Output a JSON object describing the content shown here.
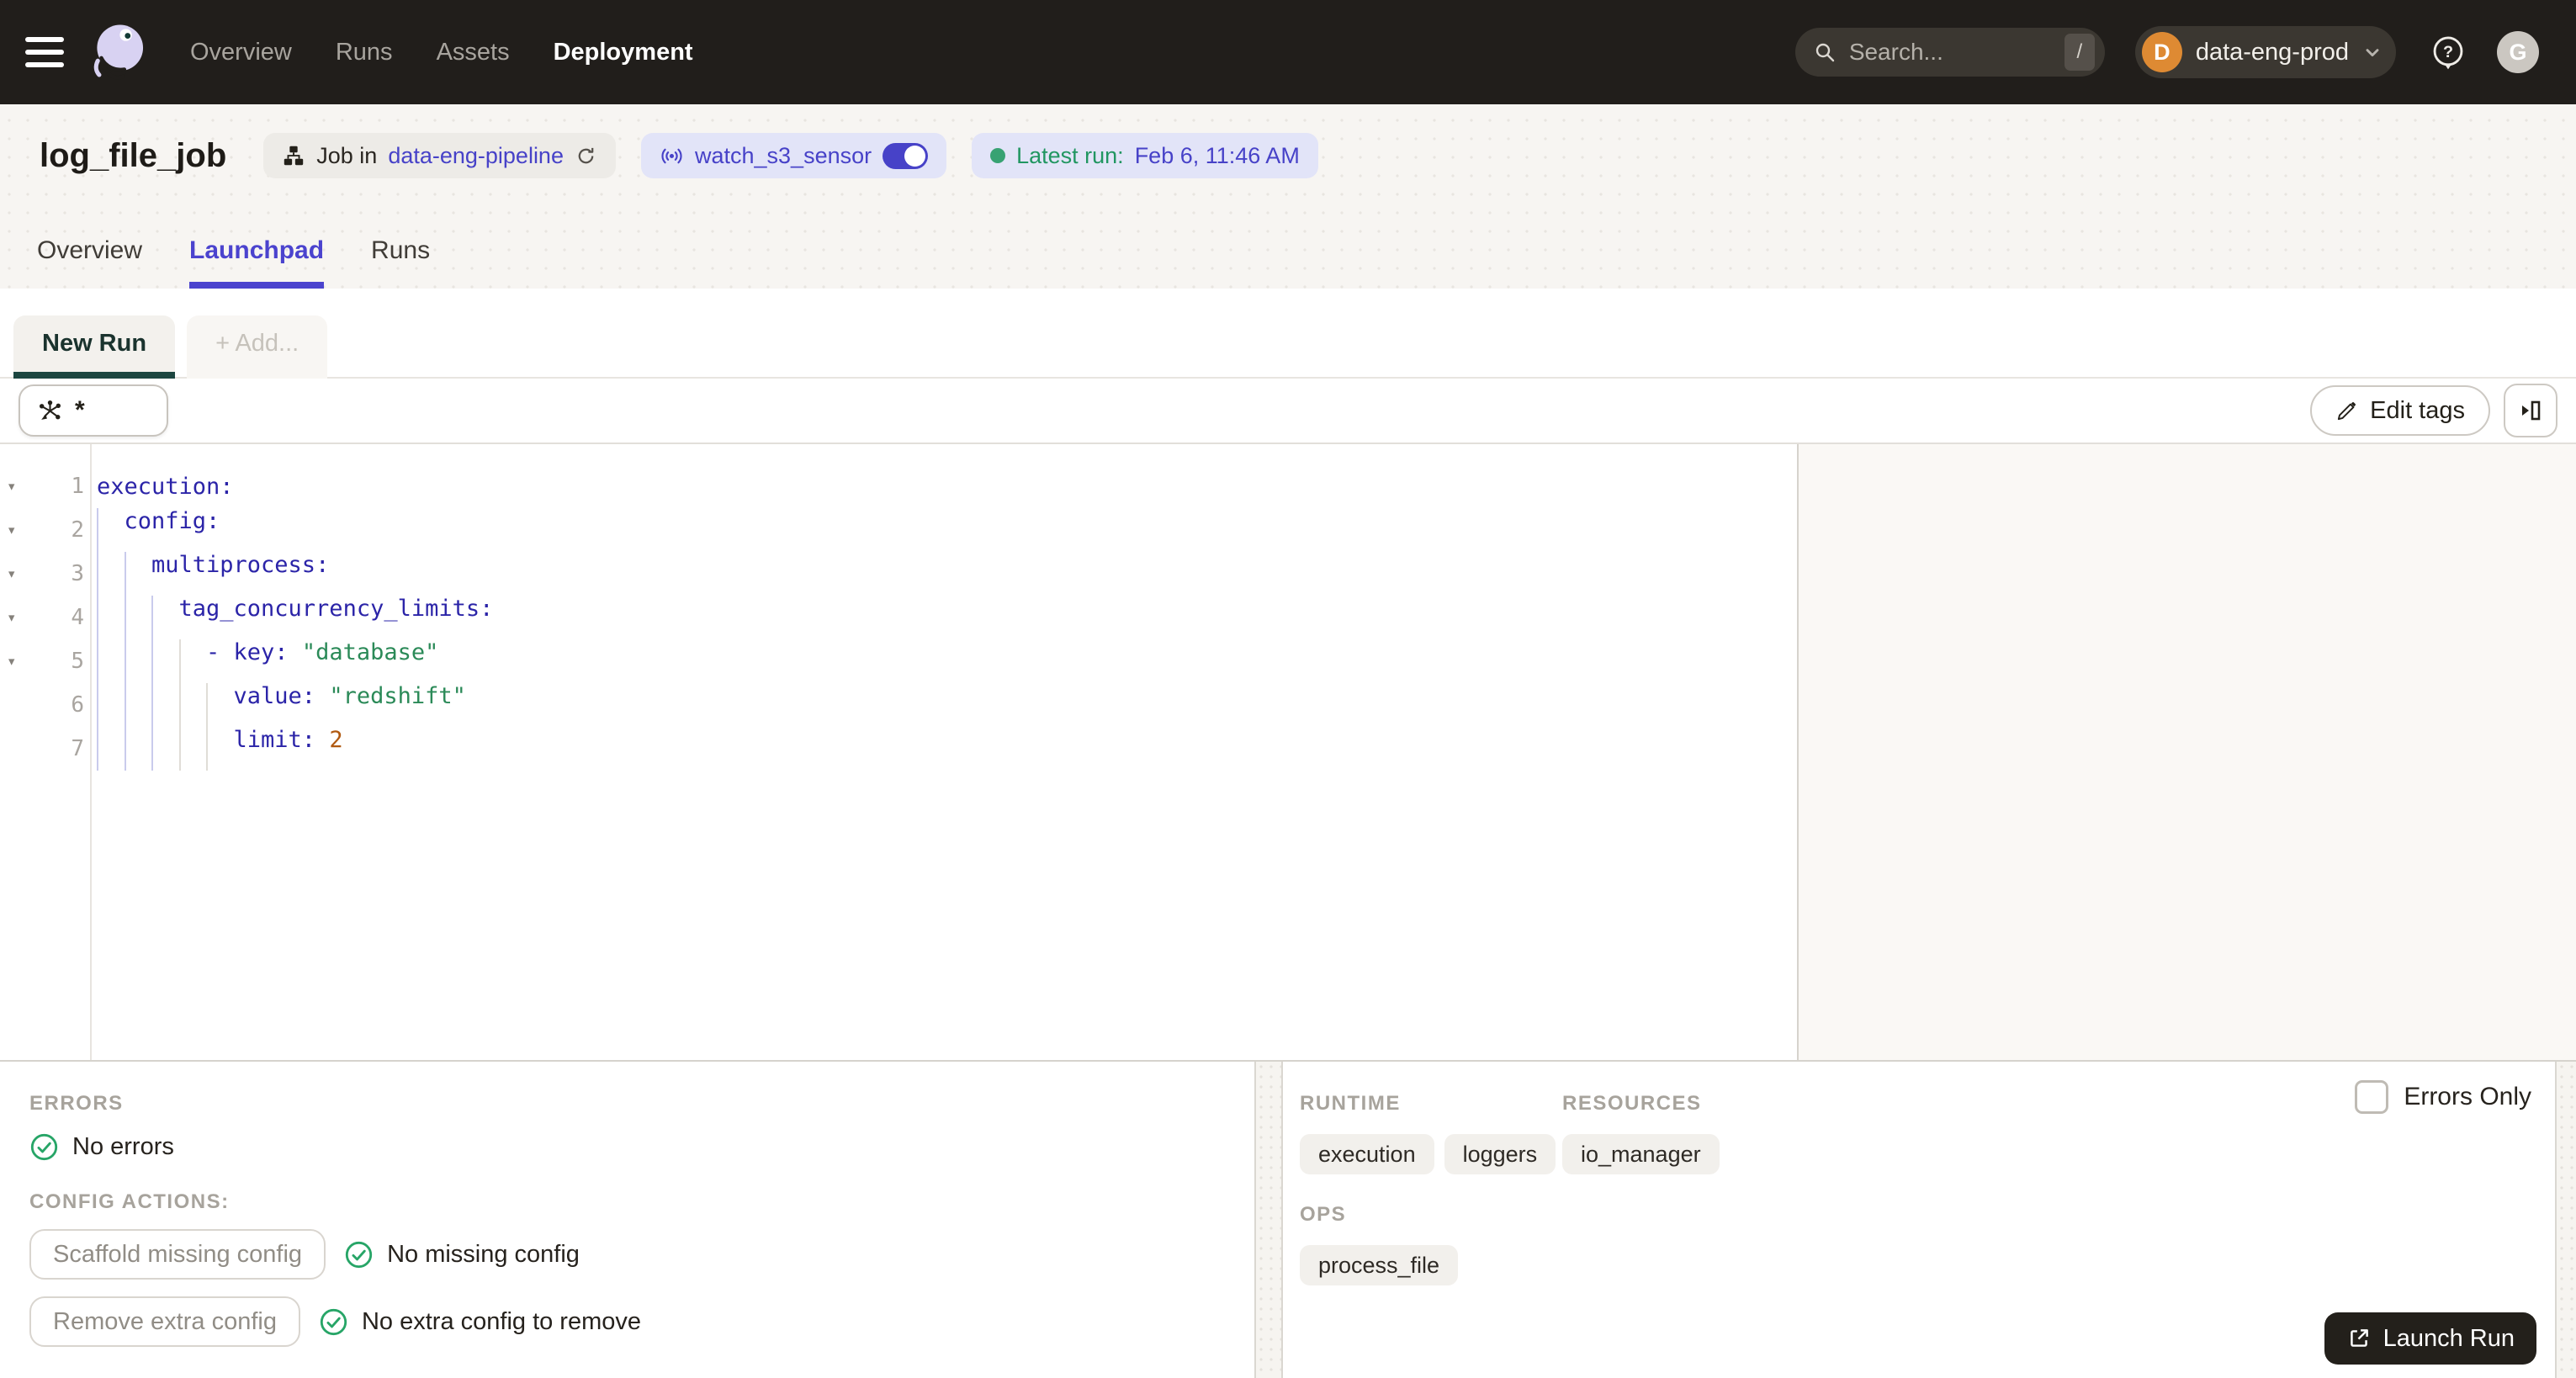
{
  "topbar": {
    "nav": [
      {
        "label": "Overview",
        "active": false
      },
      {
        "label": "Runs",
        "active": false
      },
      {
        "label": "Assets",
        "active": false
      },
      {
        "label": "Deployment",
        "active": true
      }
    ],
    "search": {
      "placeholder": "Search...",
      "shortcut": "/"
    },
    "deployment_switcher": {
      "initial": "D",
      "name": "data-eng-prod"
    },
    "user_initial": "G"
  },
  "header": {
    "title": "log_file_job",
    "job_pill": {
      "prefix": "Job in",
      "repo": "data-eng-pipeline"
    },
    "sensor_pill": {
      "name": "watch_s3_sensor"
    },
    "latest_run_pill": {
      "label": "Latest run:",
      "value": "Feb 6, 11:46 AM"
    }
  },
  "tabs": [
    {
      "label": "Overview",
      "active": false
    },
    {
      "label": "Launchpad",
      "active": true
    },
    {
      "label": "Runs",
      "active": false
    }
  ],
  "launchpad": {
    "config_tabs": [
      {
        "label": "New Run",
        "active": true
      },
      {
        "label": "+ Add...",
        "active": false
      }
    ],
    "op_selector_value": "*",
    "edit_tags_label": "Edit tags"
  },
  "editor": {
    "fold_glyph": "▾",
    "lines": [
      {
        "n": "1",
        "fold": true,
        "indent": 0,
        "parts": [
          [
            "key",
            "execution:"
          ]
        ]
      },
      {
        "n": "2",
        "fold": true,
        "indent": 1,
        "parts": [
          [
            "key",
            "config:"
          ]
        ]
      },
      {
        "n": "3",
        "fold": true,
        "indent": 2,
        "parts": [
          [
            "key",
            "multiprocess:"
          ]
        ]
      },
      {
        "n": "4",
        "fold": true,
        "indent": 3,
        "parts": [
          [
            "key",
            "tag_concurrency_limits:"
          ]
        ]
      },
      {
        "n": "5",
        "fold": true,
        "indent": 4,
        "parts": [
          [
            "pun",
            "- "
          ],
          [
            "key",
            "key:"
          ],
          [
            "sp",
            " "
          ],
          [
            "str",
            "\"database\""
          ]
        ]
      },
      {
        "n": "6",
        "fold": false,
        "indent": 5,
        "parts": [
          [
            "key",
            "value:"
          ],
          [
            "sp",
            " "
          ],
          [
            "str",
            "\"redshift\""
          ]
        ]
      },
      {
        "n": "7",
        "fold": false,
        "indent": 5,
        "parts": [
          [
            "key",
            "limit:"
          ],
          [
            "sp",
            " "
          ],
          [
            "num",
            "2"
          ]
        ]
      }
    ]
  },
  "bottom_left": {
    "errors_label": "ERRORS",
    "no_errors_text": "No errors",
    "config_actions_label": "CONFIG ACTIONS:",
    "actions": [
      {
        "button": "Scaffold missing config",
        "status": "No missing config"
      },
      {
        "button": "Remove extra config",
        "status": "No extra config to remove"
      }
    ]
  },
  "bottom_right": {
    "runtime": {
      "label": "RUNTIME",
      "tags": [
        "execution",
        "loggers"
      ]
    },
    "resources": {
      "label": "RESOURCES",
      "tags": [
        "io_manager"
      ]
    },
    "ops": {
      "label": "OPS",
      "tags": [
        "process_file"
      ]
    },
    "errors_only_label": "Errors Only",
    "launch_button_label": "Launch Run"
  },
  "colors": {
    "topbar_bg": "#211E1B",
    "accent_blue": "#4B43CE",
    "link_blue": "#4742C8",
    "success_green": "#27A567",
    "active_config_tab_teal": "#1C4640",
    "brand_orange": "#DE8A33",
    "launch_button_bg": "#23201B",
    "yaml_key": "#2B24A8",
    "yaml_string": "#2B8A58",
    "yaml_number": "#B05910"
  }
}
